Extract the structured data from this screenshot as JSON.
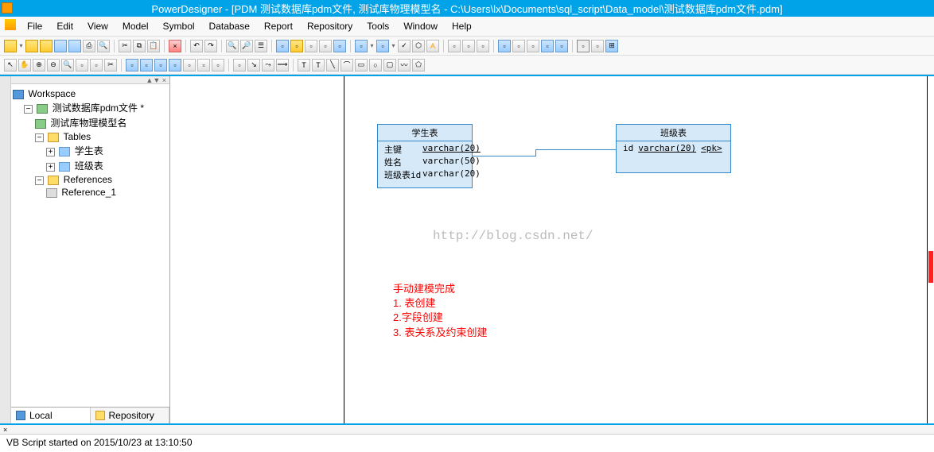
{
  "title": "PowerDesigner - [PDM 测试数据库pdm文件, 测试库物理模型名 - C:\\Users\\lx\\Documents\\sql_script\\Data_model\\测试数据库pdm文件.pdm]",
  "menu": {
    "file": "File",
    "edit": "Edit",
    "view": "View",
    "model": "Model",
    "symbol": "Symbol",
    "database": "Database",
    "report": "Report",
    "repository": "Repository",
    "tools": "Tools",
    "window": "Window",
    "help": "Help"
  },
  "sidebar": {
    "handle": "▲▼ ×",
    "tree": {
      "workspace": "Workspace",
      "project": "测试数据库pdm文件 *",
      "model": "测试库物理模型名",
      "tables_folder": "Tables",
      "table1": "学生表",
      "table2": "班级表",
      "refs_folder": "References",
      "ref1": "Reference_1"
    },
    "tabs": {
      "local": "Local",
      "repo": "Repository"
    }
  },
  "entities": {
    "student": {
      "title": "学生表",
      "rows": [
        {
          "name": "主键",
          "type": "varchar(20)"
        },
        {
          "name": "姓名",
          "type": "varchar(50)"
        },
        {
          "name": "班级表id",
          "type": "varchar(20)"
        }
      ]
    },
    "class": {
      "title": "班级表",
      "rows": [
        {
          "name": "id",
          "type": "varchar(20)",
          "pk": "<pk>"
        }
      ]
    }
  },
  "watermark": "http://blog.csdn.net/",
  "annotation": {
    "l1": "手动建模完成",
    "l2": "1. 表创建",
    "l3": "2.字段创建",
    "l4": "3. 表关系及约束创建"
  },
  "status": {
    "handle_x": "×",
    "text": "VB Script started on 2015/10/23 at 13:10:50"
  }
}
